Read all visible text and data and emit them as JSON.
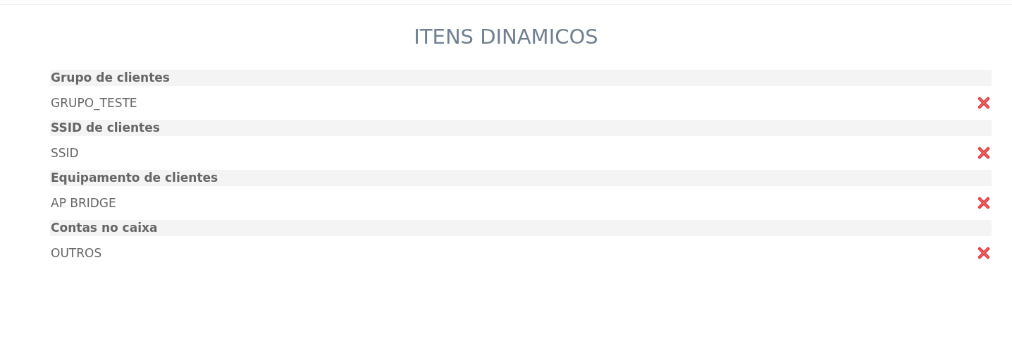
{
  "title": "ITENS DINAMICOS",
  "groups": [
    {
      "heading": "Grupo de clientes",
      "items": [
        {
          "label": "GRUPO_TESTE"
        }
      ]
    },
    {
      "heading": "SSID de clientes",
      "items": [
        {
          "label": "SSID"
        }
      ]
    },
    {
      "heading": "Equipamento de clientes",
      "items": [
        {
          "label": "AP BRIDGE"
        }
      ]
    },
    {
      "heading": "Contas no caixa",
      "items": [
        {
          "label": "OUTROS"
        }
      ]
    }
  ]
}
